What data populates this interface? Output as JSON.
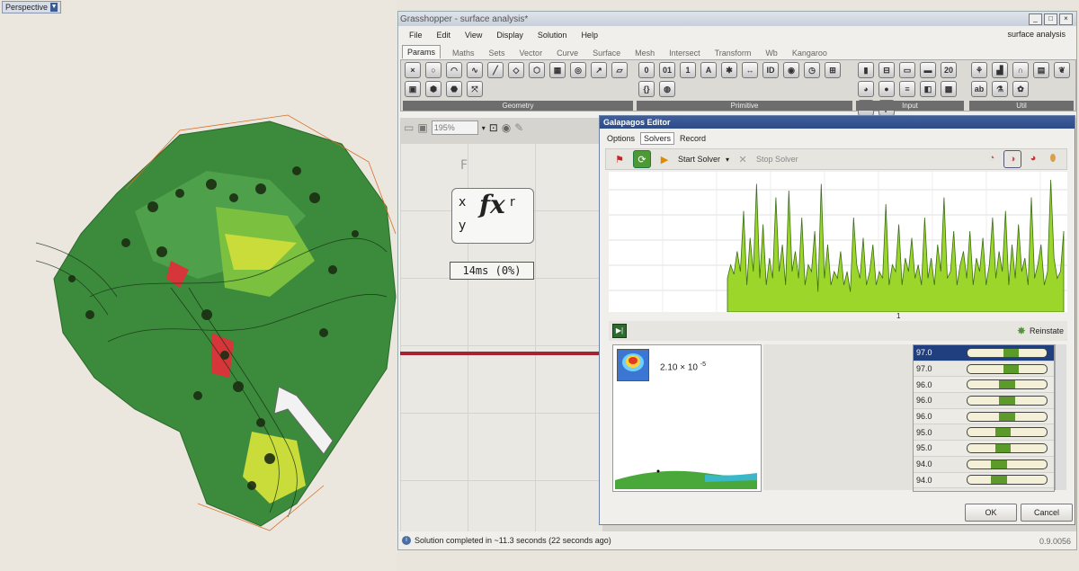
{
  "viewport": {
    "label": "Perspective"
  },
  "window": {
    "title": "Grasshopper - surface analysis*",
    "document_name": "surface analysis",
    "menu": [
      "File",
      "Edit",
      "View",
      "Display",
      "Solution",
      "Help"
    ],
    "tabs": [
      "Params",
      "Maths",
      "Sets",
      "Vector",
      "Curve",
      "Surface",
      "Mesh",
      "Intersect",
      "Transform",
      "Wb",
      "Kangaroo"
    ],
    "active_tab": "Params",
    "ribbon_groups": [
      "Geometry",
      "Primitive",
      "Input",
      "Util"
    ],
    "zoom": "195%"
  },
  "component": {
    "inputs": [
      "F",
      "x",
      "y"
    ],
    "output": "r",
    "symbol": "fx",
    "timer": "14ms (0%)"
  },
  "status": {
    "message": "Solution completed in ~11.3 seconds (22 seconds ago)",
    "version": "0.9.0056"
  },
  "galapagos": {
    "title": "Galapagos Editor",
    "tabs": [
      "Options",
      "Solvers",
      "Record"
    ],
    "active_tab": "Solvers",
    "start_label": "Start Solver",
    "stop_label": "Stop Solver",
    "reinstate_label": "Reinstate",
    "fitness_base": "2.10 × 10",
    "fitness_exp": "-5",
    "genomes": [
      {
        "value": "97.0",
        "fill": 0.55
      },
      {
        "value": "97.0",
        "fill": 0.55
      },
      {
        "value": "96.0",
        "fill": 0.5
      },
      {
        "value": "96.0",
        "fill": 0.5
      },
      {
        "value": "96.0",
        "fill": 0.5
      },
      {
        "value": "95.0",
        "fill": 0.45
      },
      {
        "value": "95.0",
        "fill": 0.45
      },
      {
        "value": "94.0",
        "fill": 0.4
      },
      {
        "value": "94.0",
        "fill": 0.4
      }
    ],
    "ok_label": "OK",
    "cancel_label": "Cancel"
  },
  "chart_data": {
    "type": "area",
    "x_tick": "1",
    "series": [
      {
        "values": [
          0.25,
          0.35,
          0.28,
          0.45,
          0.3,
          0.75,
          0.2,
          0.55,
          0.3,
          0.95,
          0.25,
          0.65,
          0.2,
          0.4,
          0.25,
          0.85,
          0.3,
          0.5,
          0.2,
          0.9,
          0.3,
          0.45,
          0.25,
          0.7,
          0.2,
          0.35,
          0.3,
          0.6,
          0.15,
          0.95,
          0.25,
          0.5,
          0.2,
          0.3,
          0.25,
          0.45,
          0.2,
          0.3,
          0.15,
          0.7,
          0.35,
          0.25,
          0.55,
          0.2,
          0.3,
          0.5,
          0.2,
          0.3,
          0.25,
          0.8,
          0.2,
          0.35,
          0.3,
          0.65,
          0.2,
          0.4,
          0.3,
          0.55,
          0.25,
          0.35,
          0.2,
          0.7,
          0.25,
          0.4,
          0.2,
          0.5,
          0.3,
          0.85,
          0.25,
          0.3,
          0.6,
          0.2,
          0.35,
          0.45,
          0.25,
          0.6,
          0.2,
          0.4,
          0.3,
          0.55,
          0.2,
          0.35,
          0.7,
          0.25,
          0.45,
          0.3,
          0.75,
          0.2,
          0.5,
          0.25,
          0.65,
          0.3,
          0.4,
          0.2,
          0.85,
          0.25,
          0.35,
          0.5,
          0.2,
          0.3,
          0.98,
          0.4,
          0.25,
          0.3,
          0.6
        ]
      }
    ]
  }
}
